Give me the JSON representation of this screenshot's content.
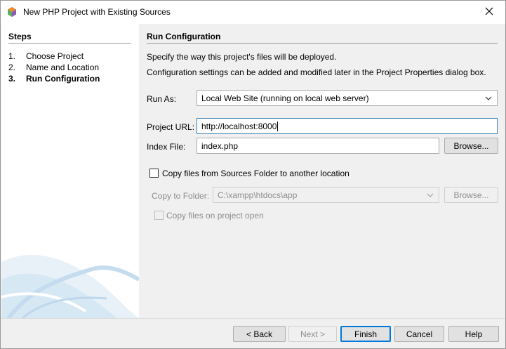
{
  "window": {
    "title": "New PHP Project with Existing Sources"
  },
  "steps": {
    "heading": "Steps",
    "items": [
      {
        "num": "1.",
        "label": "Choose Project",
        "current": false
      },
      {
        "num": "2.",
        "label": "Name and Location",
        "current": false
      },
      {
        "num": "3.",
        "label": "Run Configuration",
        "current": true
      }
    ]
  },
  "panel": {
    "heading": "Run Configuration",
    "desc1": "Specify the way this project's files will be deployed.",
    "desc2": "Configuration settings can be added and modified later in the Project Properties dialog box."
  },
  "form": {
    "run_as_label": "Run As:",
    "run_as_value": "Local Web Site (running on local web server)",
    "project_url_label": "Project URL:",
    "project_url_value": "http://localhost:8000",
    "index_file_label": "Index File:",
    "index_file_value": "index.php",
    "browse_label": "Browse...",
    "copy_files_label": "Copy files from Sources Folder to another location",
    "copy_files_checked": false,
    "copy_to_label": "Copy to Folder:",
    "copy_to_value": "C:\\xampp\\htdocs\\app",
    "copy_browse_label": "Browse...",
    "copy_on_open_label": "Copy files on project open",
    "copy_on_open_checked": false
  },
  "footer": {
    "back_label": "< Back",
    "next_label": "Next >",
    "finish_label": "Finish",
    "cancel_label": "Cancel",
    "help_label": "Help"
  },
  "icons": {
    "app": "netbeans-cube-icon",
    "close": "close-icon",
    "combo": "chevron-down-icon"
  },
  "colors": {
    "accent": "#0078d7",
    "swoosh": "#cfe3f2"
  }
}
